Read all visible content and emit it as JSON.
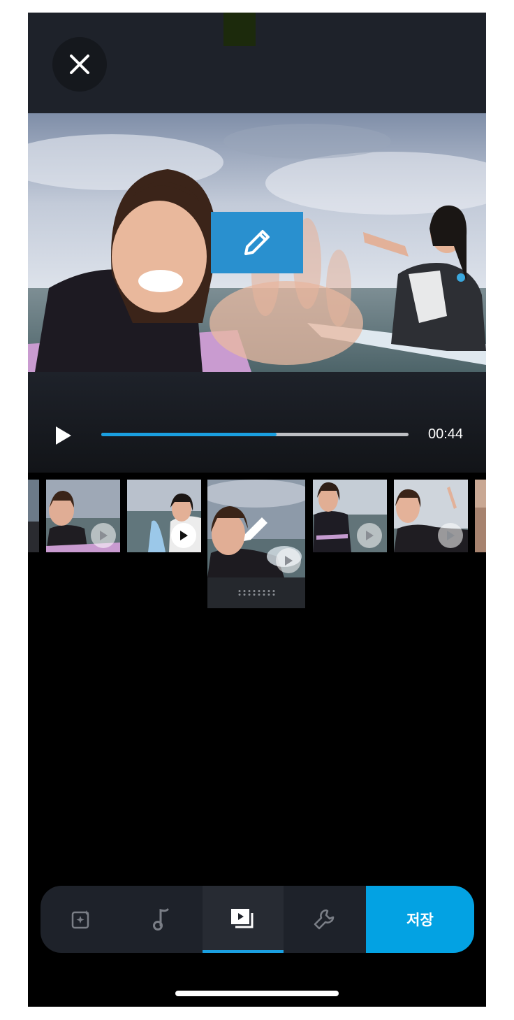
{
  "player": {
    "duration": "00:44",
    "progress": 0.57
  },
  "save": {
    "label": "저장"
  },
  "tabs": [
    {
      "icon": "sparkle-frame-icon",
      "active": false
    },
    {
      "icon": "music-note-icon",
      "active": false
    },
    {
      "icon": "clips-icon",
      "active": true
    },
    {
      "icon": "wrench-icon",
      "active": false
    }
  ],
  "colors": {
    "accent": "#03a2e3",
    "edit_overlay": "#2990cf",
    "panel": "#1e222a"
  }
}
